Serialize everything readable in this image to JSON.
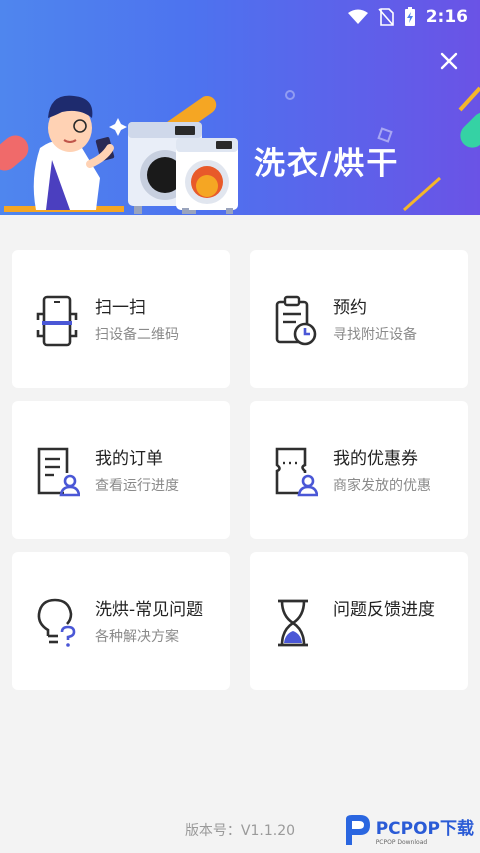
{
  "status_bar": {
    "time": "2:16"
  },
  "header": {
    "title": "洗衣/烘干"
  },
  "cards": [
    {
      "title": "扫一扫",
      "subtitle": "扫设备二维码",
      "icon": "scan-phone-icon"
    },
    {
      "title": "预约",
      "subtitle": "寻找附近设备",
      "icon": "clipboard-clock-icon"
    },
    {
      "title": "我的订单",
      "subtitle": "查看运行进度",
      "icon": "order-doc-user-icon"
    },
    {
      "title": "我的优惠券",
      "subtitle": "商家发放的优惠",
      "icon": "coupon-user-icon"
    },
    {
      "title": "洗烘-常见问题",
      "subtitle": "各种解决方案",
      "icon": "lightbulb-question-icon"
    },
    {
      "title": "问题反馈进度",
      "subtitle": "",
      "icon": "hourglass-icon"
    }
  ],
  "footer": {
    "version": "版本号：V1.1.20"
  },
  "watermark": {
    "brand": "PCPOP下载",
    "sub": "PCPOP Download"
  },
  "colors": {
    "accent": "#4a57d6",
    "header_start": "#4f86ee",
    "header_end": "#6a53e6"
  }
}
